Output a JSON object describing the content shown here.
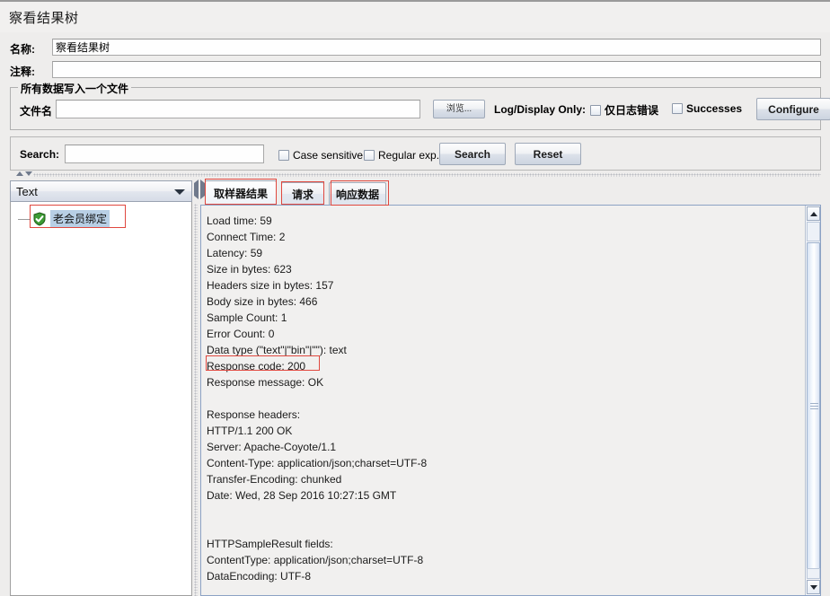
{
  "window": {
    "title": "察看结果树"
  },
  "form": {
    "name_label": "名称:",
    "name_value": "察看结果树",
    "comment_label": "注释:",
    "comment_value": ""
  },
  "file_panel": {
    "group_title": "所有数据写入一个文件",
    "filename_label": "文件名",
    "filename_value": "",
    "browse_button": "浏览...",
    "log_display_label": "Log/Display Only:",
    "errors_only_label": "仅日志错误",
    "errors_only_checked": false,
    "successes_label": "Successes",
    "successes_checked": false,
    "configure_button": "Configure"
  },
  "search_panel": {
    "search_label": "Search:",
    "search_value": "",
    "case_sensitive_label": "Case sensitive",
    "case_sensitive_checked": false,
    "regular_exp_label": "Regular exp.",
    "regular_exp_checked": false,
    "search_button": "Search",
    "reset_button": "Reset"
  },
  "left_pane": {
    "view_selector_value": "Text",
    "tree": {
      "nodes": [
        {
          "label": "老会员绑定",
          "status_icon": "green-check-shield-icon",
          "selected": true
        }
      ]
    }
  },
  "right_pane": {
    "tabs": [
      {
        "label": "取样器结果",
        "selected": true
      },
      {
        "label": "请求",
        "selected": false
      },
      {
        "label": "响应数据",
        "selected": false
      }
    ],
    "content_lines": [
      "Load time: 59",
      "Connect Time: 2",
      "Latency: 59",
      "Size in bytes: 623",
      "Headers size in bytes: 157",
      "Body size in bytes: 466",
      "Sample Count: 1",
      "Error Count: 0",
      "Data type (\"text\"|\"bin\"|\"\"): text",
      "Response code: 200",
      "Response message: OK",
      "",
      "Response headers:",
      "HTTP/1.1 200 OK",
      "Server: Apache-Coyote/1.1",
      "Content-Type: application/json;charset=UTF-8",
      "Transfer-Encoding: chunked",
      "Date: Wed, 28 Sep 2016 10:27:15 GMT",
      "",
      "",
      "HTTPSampleResult fields:",
      "ContentType: application/json;charset=UTF-8",
      "DataEncoding: UTF-8"
    ]
  },
  "annotations": {
    "color": "#e0483f",
    "boxes": [
      "tab-sampler-result",
      "tab-request",
      "tab-response-data",
      "tree-node-label",
      "response-code-line"
    ]
  }
}
